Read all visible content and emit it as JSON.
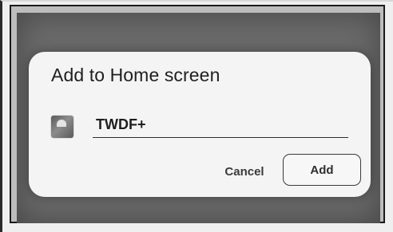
{
  "dialog": {
    "title": "Add to Home screen",
    "app_icon": "app-shortcut-icon",
    "name_value": "TWDF+",
    "cancel_label": "Cancel",
    "add_label": "Add"
  },
  "colors": {
    "dialog_background": "#f4f4f4",
    "scrim": "#6a6a6a",
    "text": "#1f1f1f",
    "button_border": "#3a3a3a"
  }
}
